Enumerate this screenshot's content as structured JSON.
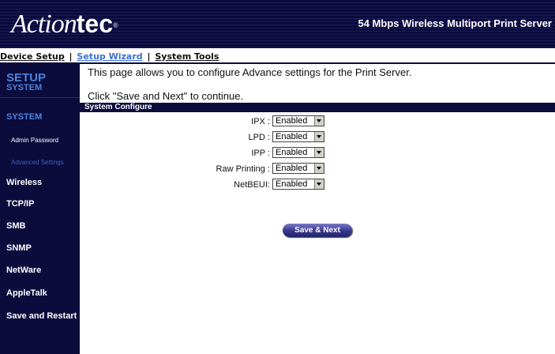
{
  "header": {
    "logo_script": "Action",
    "logo_bold": "tec",
    "logo_mark": "®",
    "product_title": "54 Mbps Wireless Multiport Print Server"
  },
  "topnav": {
    "items": [
      "Device Setup",
      "Setup Wizard",
      "System Tools"
    ],
    "separator": "|",
    "active": "Setup Wizard"
  },
  "sidebar": {
    "heading": "SETUP",
    "subheading": "SYSTEM",
    "system_label": "SYSTEM",
    "sub_items": [
      "Admin Password",
      "Advanced Settings"
    ],
    "active_sub": "Advanced Settings",
    "items": [
      "Wireless",
      "TCP/IP",
      "SMB",
      "SNMP",
      "NetWare",
      "AppleTalk",
      "Save and Restart"
    ]
  },
  "main": {
    "intro": "This page allows you to configure Advance settings for the Print Server.",
    "instruction": "Click \"Save and Next\" to continue.",
    "section_title": "System Configure",
    "fields": [
      {
        "label": "IPX :",
        "value": "Enabled"
      },
      {
        "label": "LPD :",
        "value": "Enabled"
      },
      {
        "label": "IPP :",
        "value": "Enabled"
      },
      {
        "label": "Raw Printing :",
        "value": "Enabled"
      },
      {
        "label": "NetBEUI:",
        "value": "Enabled"
      }
    ],
    "save_button": "Save & Next"
  },
  "colors": {
    "navy": "#0b0b3c",
    "accent_blue": "#4a84e0",
    "link_blue": "#3b6fd1"
  }
}
